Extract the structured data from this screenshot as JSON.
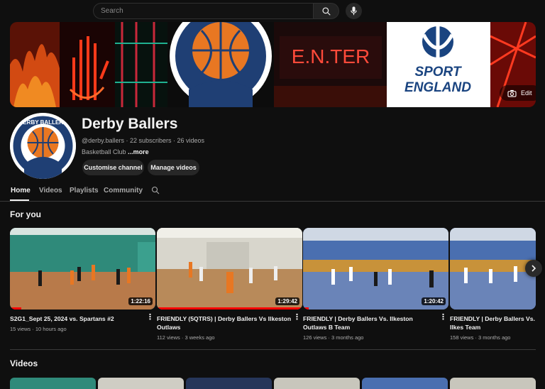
{
  "search": {
    "placeholder": "Search"
  },
  "banner": {
    "edit_label": "Edit",
    "neon_text": "E.N.TER",
    "sport_line1": "SPORT",
    "sport_line2": "ENGLAND",
    "crest_text": "DERBY BALLERS"
  },
  "channel": {
    "name": "Derby Ballers",
    "meta": "@derby.ballers · 22 subscribers · 26 videos",
    "description": "Basketball Club",
    "more_label": "...more",
    "customise_label": "Customise channel",
    "manage_label": "Manage videos"
  },
  "tabs": [
    "Home",
    "Videos",
    "Playlists",
    "Community"
  ],
  "sections": {
    "for_you": "For you",
    "videos": "Videos"
  },
  "videos": [
    {
      "title": "S2G1_Sept 25, 2024 vs. Spartans #2",
      "meta": "15 views · 10 hours ago",
      "duration": "1:22:16"
    },
    {
      "title": "FRIENDLY (5QTRS) | Derby Ballers Vs Ilkeston Outlaws",
      "meta": "112 views · 3 weeks ago",
      "duration": "1:29:42"
    },
    {
      "title": "FRIENDLY | Derby Ballers Vs. Ilkeston Outlaws B Team",
      "meta": "126 views · 3 months ago",
      "duration": "1:20:42"
    },
    {
      "title": "FRIENDLY | Derby Ballers Vs. Ilkes Team",
      "meta": "158 views · 3 months ago",
      "duration": ""
    }
  ],
  "colors": {
    "accent": "#ff0000",
    "background": "#0f0f0f",
    "crest_blue": "#1f3f74",
    "crest_orange": "#e87722"
  }
}
